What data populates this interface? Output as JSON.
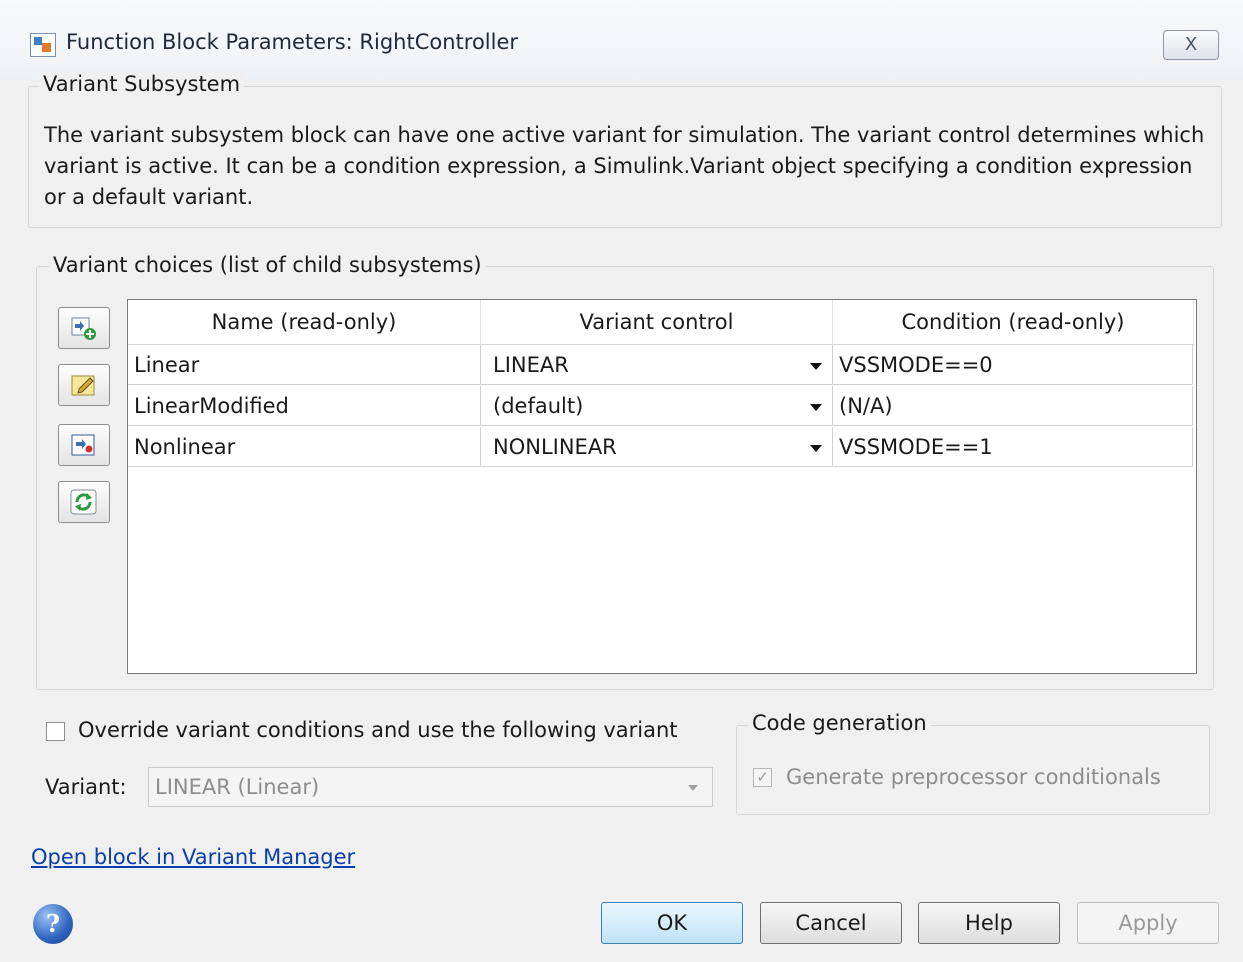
{
  "window": {
    "title": "Function Block Parameters: RightController",
    "close_glyph": "X"
  },
  "variant_subsystem": {
    "group_label": "Variant Subsystem",
    "description": "The variant subsystem block can have one active variant for simulation. The variant control determines which variant is active. It can be a condition expression, a Simulink.Variant object specifying a condition expression or a default variant."
  },
  "variant_choices": {
    "group_label": "Variant choices (list of child subsystems)",
    "toolbar_icons": [
      "add-choice-icon",
      "edit-choice-icon",
      "open-choice-icon",
      "refresh-icon"
    ],
    "columns": [
      "Name (read-only)",
      "Variant control",
      "Condition (read-only)"
    ],
    "rows": [
      {
        "name": "Linear",
        "control": "LINEAR",
        "condition": "VSSMODE==0"
      },
      {
        "name": "LinearModified",
        "control": "(default)",
        "condition": "(N/A)"
      },
      {
        "name": "Nonlinear",
        "control": "NONLINEAR",
        "condition": "VSSMODE==1"
      }
    ]
  },
  "override": {
    "checkbox_label": "Override variant conditions and use the following variant",
    "checked": false,
    "variant_label": "Variant:",
    "variant_value": "LINEAR (Linear)"
  },
  "code_generation": {
    "group_label": "Code generation",
    "checkbox_label": "Generate preprocessor conditionals",
    "checked": true,
    "check_glyph": "✓"
  },
  "footer": {
    "link": "Open block in Variant Manager",
    "help_glyph": "?",
    "buttons": {
      "ok": "OK",
      "cancel": "Cancel",
      "help": "Help",
      "apply": "Apply"
    }
  }
}
